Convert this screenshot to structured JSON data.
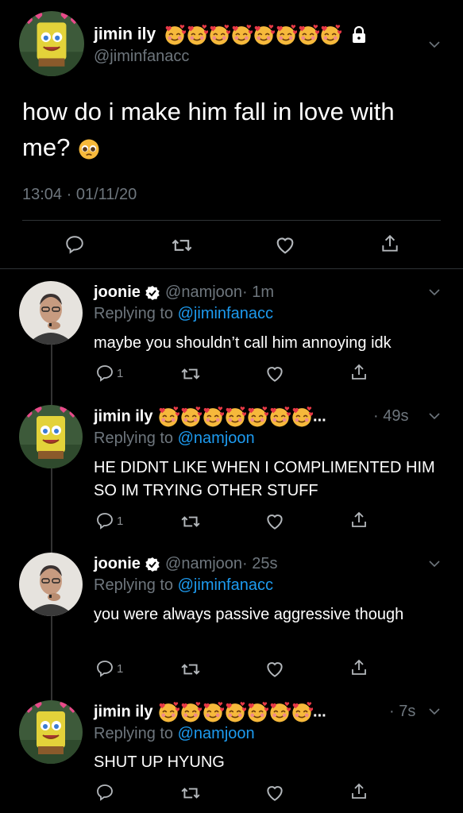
{
  "main_tweet": {
    "display_name": "jimin ily",
    "handle": "@jiminfanacc",
    "text": "how do i make him fall in love with me?",
    "text_emoji": "pleading-face-emoji",
    "timestamp": "13:04 · 01/11/20",
    "name_emoji": "smiling-face-with-hearts-emoji",
    "lock_icon": "lock-icon"
  },
  "replies": [
    {
      "display_name": "joonie",
      "verified": true,
      "handle": "@namjoon",
      "age": "· 1m",
      "replying_label": "Replying to",
      "replying_to": "@jiminfanacc",
      "text": "maybe you shouldn’t call him annoying idk",
      "reply_count": "1"
    },
    {
      "display_name": "jimin ily",
      "name_suffix": "...",
      "handle": "",
      "age": "· 49s",
      "replying_label": "Replying to",
      "replying_to": "@namjoon",
      "text": "HE DIDNT LIKE WHEN I COMPLIMENTED HIM SO IM TRYING OTHER STUFF",
      "reply_count": "1"
    },
    {
      "display_name": "joonie",
      "verified": true,
      "handle": "@namjoon",
      "age": "· 25s",
      "replying_label": "Replying to",
      "replying_to": "@jiminfanacc",
      "text": "you were always passive aggressive though",
      "reply_count": "1"
    },
    {
      "display_name": "jimin ily",
      "name_suffix": "...",
      "handle": "",
      "age": "· 7s",
      "replying_label": "Replying to",
      "replying_to": "@namjoon",
      "text": "SHUT UP HYUNG",
      "reply_count": ""
    }
  ],
  "colors": {
    "background": "#000000",
    "link": "#1d9bf0",
    "muted": "#6e767d",
    "divider": "#2f3336"
  }
}
